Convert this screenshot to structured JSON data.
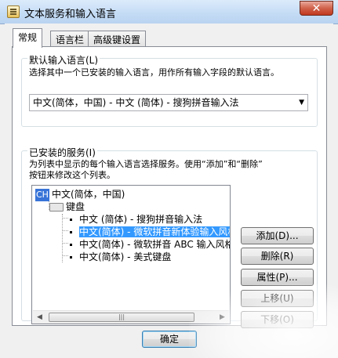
{
  "window": {
    "title": "文本服务和输入语言",
    "close_glyph": "✕"
  },
  "tabs": [
    {
      "label": "常规",
      "active": true
    },
    {
      "label": "语言栏",
      "active": false
    },
    {
      "label": "高级键设置",
      "active": false
    }
  ],
  "default_language": {
    "group_label": "默认输入语言(L)",
    "description": "选择其中一个已安装的输入语言，用作所有输入字段的默认语言。",
    "selected": "中文(简体，中国) - 中文 (简体) - 搜狗拼音输入法"
  },
  "installed": {
    "group_label": "已安装的服务(I)",
    "description_line1": "为列表中显示的每个输入语言选择服务。使用“添加”和“删除”",
    "description_line2": "按钮来修改这个列表。",
    "tree": {
      "language_badge": "CH",
      "language_name": "中文(简体，中国)",
      "category": "键盘",
      "items": [
        {
          "label": "中文 (简体) - 搜狗拼音输入法",
          "selected": false
        },
        {
          "label": "中文(简体) - 微软拼音新体验输入风格",
          "selected": true
        },
        {
          "label": "中文(简体) - 微软拼音 ABC 输入风格",
          "selected": false
        },
        {
          "label": "中文(简体) - 美式键盘",
          "selected": false
        }
      ]
    },
    "buttons": {
      "add": "添加(D)...",
      "remove": "删除(R)",
      "properties": "属性(P)...",
      "move_up": "上移(U)",
      "move_down": "下移(O)"
    }
  },
  "footer": {
    "ok": "确定"
  }
}
